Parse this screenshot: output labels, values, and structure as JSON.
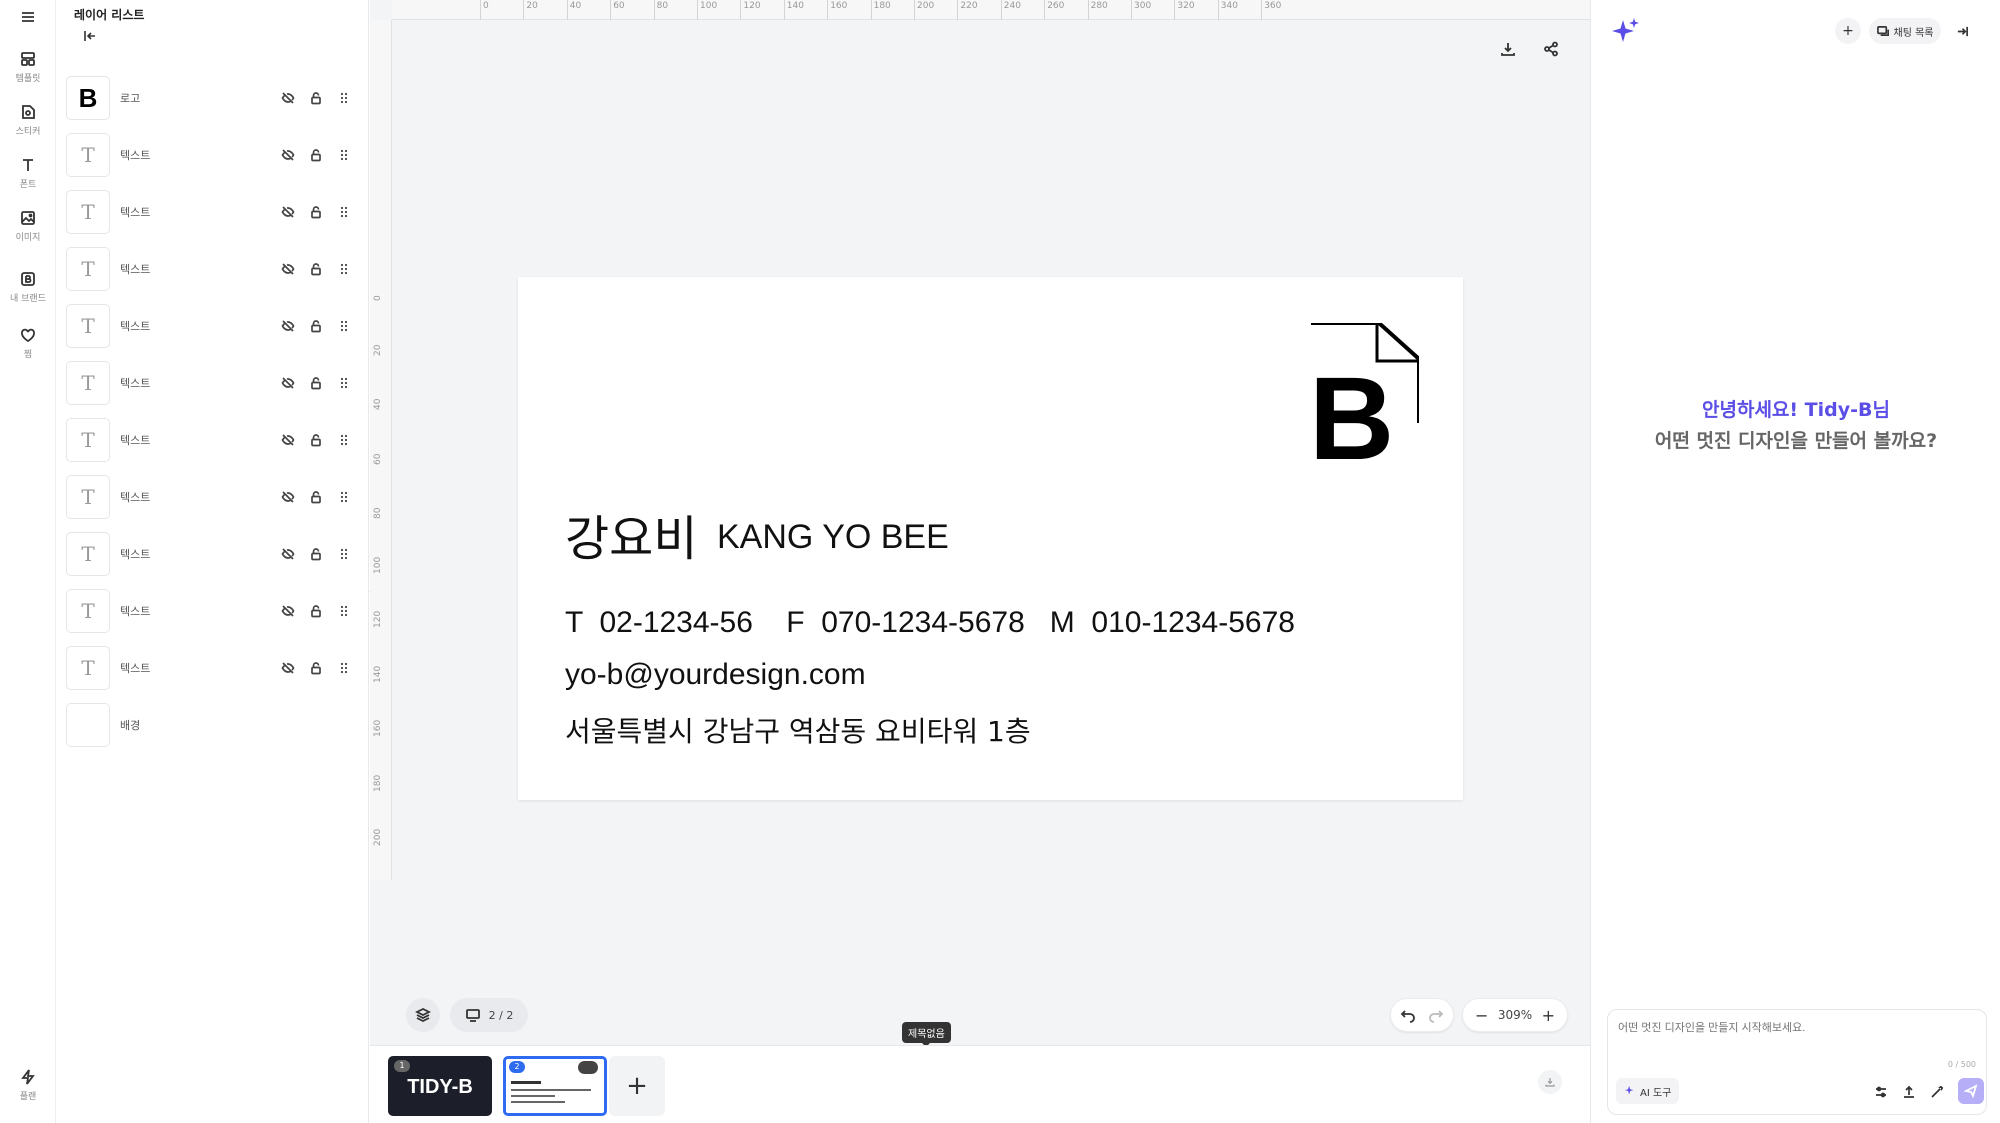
{
  "rail": {
    "items": [
      {
        "label": "템플릿",
        "icon": "template-icon"
      },
      {
        "label": "스티커",
        "icon": "sticker-icon"
      },
      {
        "label": "폰트",
        "icon": "font-icon"
      },
      {
        "label": "이미지",
        "icon": "image-icon"
      },
      {
        "label": "내 브랜드",
        "icon": "brand-icon"
      },
      {
        "label": "찜",
        "icon": "heart-icon"
      }
    ],
    "plan_label": "플랜"
  },
  "layers": {
    "title": "레이어 리스트",
    "items": [
      {
        "name": "로고",
        "type": "logo"
      },
      {
        "name": "텍스트",
        "type": "text"
      },
      {
        "name": "텍스트",
        "type": "text"
      },
      {
        "name": "텍스트",
        "type": "text"
      },
      {
        "name": "텍스트",
        "type": "text"
      },
      {
        "name": "텍스트",
        "type": "text"
      },
      {
        "name": "텍스트",
        "type": "text"
      },
      {
        "name": "텍스트",
        "type": "text"
      },
      {
        "name": "텍스트",
        "type": "text"
      },
      {
        "name": "텍스트",
        "type": "text"
      },
      {
        "name": "텍스트",
        "type": "text"
      },
      {
        "name": "배경",
        "type": "background"
      }
    ],
    "text_thumb_glyph": "T",
    "logo_thumb_glyph": "B"
  },
  "ruler": {
    "top_labels": [
      "0",
      "20",
      "40",
      "60",
      "80",
      "100",
      "120",
      "140",
      "160",
      "180",
      "200",
      "220",
      "240",
      "260",
      "280",
      "300",
      "320",
      "340",
      "360"
    ],
    "left_labels": [
      "0",
      "20",
      "40",
      "60",
      "80",
      "100",
      "120",
      "140",
      "160",
      "180",
      "200"
    ]
  },
  "card": {
    "name_ko": "강요비",
    "name_en": "KANG YO BEE",
    "phones": "T  02-1234-56    F  070-1234-5678   M  010-1234-5678",
    "email": "yo-b@yourdesign.com",
    "address": "서울특별시 강남구 역삼동 요비타워 1층",
    "logo_letter": "B"
  },
  "canvas_controls": {
    "page_indicator": "2 / 2",
    "zoom": "309%",
    "tooltip": "제목없음"
  },
  "pages": [
    {
      "number": "1",
      "label": "TIDY-B",
      "selected": false
    },
    {
      "number": "2",
      "label": "",
      "selected": true
    }
  ],
  "ai_panel": {
    "chat_list_label": "채팅 목록",
    "greeting_line1": "안녕하세요! Tidy-B님",
    "greeting_line2": "어떤 멋진 디자인을 만들어 볼까요?",
    "input_placeholder": "어떤 멋진 디자인을 만들지 시작해보세요.",
    "char_count": "0 / 500",
    "ai_tool_label": "AI 도구"
  },
  "colors": {
    "accent": "#5b4ee6",
    "send_button": "#b6aef7",
    "selected_page_border": "#2f6bf0",
    "dark_page": "#1c1f2a"
  }
}
